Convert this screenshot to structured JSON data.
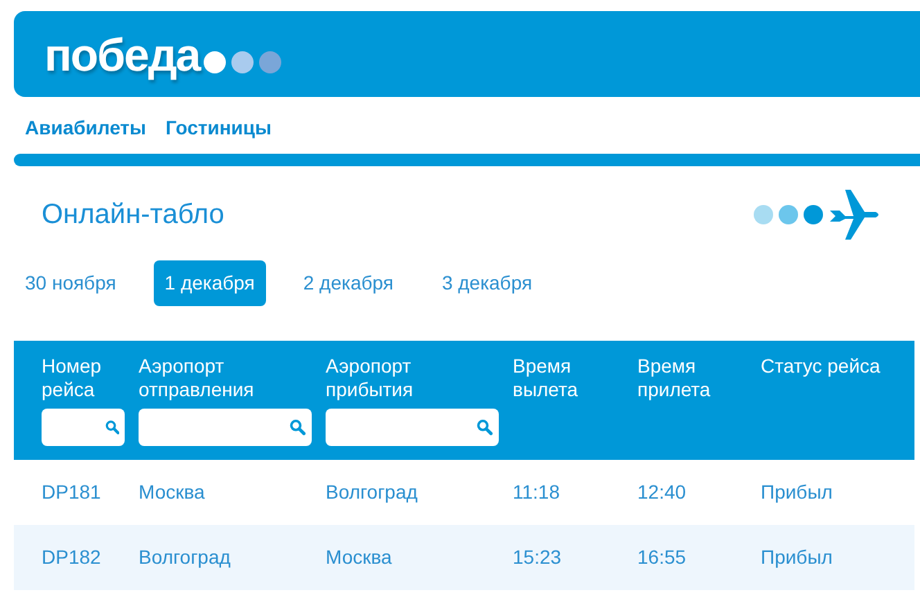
{
  "logo": {
    "text": "победа"
  },
  "nav": [
    {
      "label": "Авиабилеты"
    },
    {
      "label": "Гостиницы"
    }
  ],
  "title": "Онлайн-табло",
  "dates": [
    {
      "label": "30 ноября",
      "selected": false
    },
    {
      "label": "1 декабря",
      "selected": true
    },
    {
      "label": "2 декабря",
      "selected": false
    },
    {
      "label": "3 декабря",
      "selected": false
    }
  ],
  "table": {
    "columns": [
      {
        "label": "Номер рейса",
        "filter": true
      },
      {
        "label": "Аэропорт отправления",
        "filter": true
      },
      {
        "label": "Аэропорт прибытия",
        "filter": true
      },
      {
        "label": "Время вылета",
        "filter": false
      },
      {
        "label": "Время прилета",
        "filter": false
      },
      {
        "label": "Статус рейса",
        "filter": false
      }
    ],
    "rows": [
      [
        "DP181",
        "Москва",
        "Волгоград",
        "11:18",
        "12:40",
        "Прибыл"
      ],
      [
        "DP182",
        "Волгоград",
        "Москва",
        "15:23",
        "16:55",
        "Прибыл"
      ]
    ]
  }
}
